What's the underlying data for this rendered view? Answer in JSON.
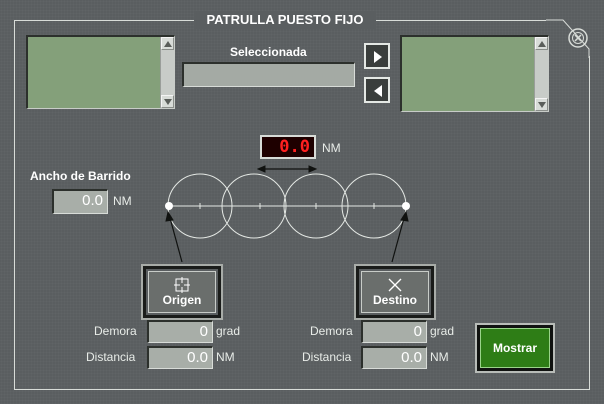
{
  "window": {
    "title": "PATRULLA PUESTO FIJO"
  },
  "selection": {
    "label": "Seleccionada",
    "value": ""
  },
  "lists": {
    "left_items": [],
    "right_items": []
  },
  "spacing": {
    "value": "0.0",
    "unit": "NM"
  },
  "sweep": {
    "label": "Ancho de Barrido",
    "value": "0.0",
    "unit": "NM"
  },
  "origin": {
    "button_label": "Origen",
    "bearing_label": "Demora",
    "bearing_value": "0",
    "bearing_unit": "grad",
    "distance_label": "Distancia",
    "distance_value": "0.0",
    "distance_unit": "NM"
  },
  "destination": {
    "button_label": "Destino",
    "bearing_label": "Demora",
    "bearing_value": "0",
    "bearing_unit": "grad",
    "distance_label": "Distancia",
    "distance_value": "0.0",
    "distance_unit": "NM"
  },
  "actions": {
    "show_label": "Mostrar"
  },
  "icons": {
    "close": "close-circle-icon",
    "move_right": "arrow-right-icon",
    "move_left": "arrow-left-icon",
    "origin": "crosshair-square-icon",
    "destination": "x-cross-icon"
  },
  "colors": {
    "panel": "#5a5e60",
    "list": "#84a07a",
    "led_text": "#ff2020",
    "show_button": "#2e7d16",
    "frame": "#d8dcd8"
  }
}
